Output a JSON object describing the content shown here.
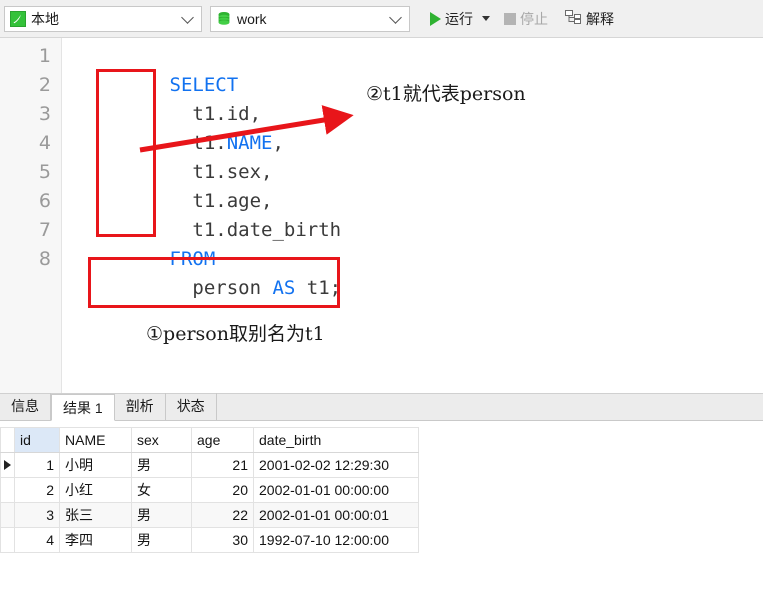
{
  "toolbar": {
    "connection": {
      "label": "本地",
      "icon": "connection-icon"
    },
    "database": {
      "label": "work",
      "icon": "database-icon"
    },
    "run": {
      "label": "运行",
      "icon": "play-icon"
    },
    "stop": {
      "label": "停止",
      "icon": "stop-icon"
    },
    "explain": {
      "label": "解释",
      "icon": "explain-icon"
    }
  },
  "editor": {
    "line_numbers": [
      "1",
      "2",
      "3",
      "4",
      "5",
      "6",
      "7",
      "8"
    ],
    "lines": [
      {
        "keyword": "SELECT",
        "plain": ""
      },
      {
        "keyword": "",
        "plain": "  t1.id,"
      },
      {
        "keyword": "",
        "plain": "  t1.",
        "keyword2": "NAME",
        "plain2": ","
      },
      {
        "keyword": "",
        "plain": "  t1.sex,"
      },
      {
        "keyword": "",
        "plain": "  t1.age,"
      },
      {
        "keyword": "",
        "plain": "  t1.date_birth"
      },
      {
        "keyword": "FROM",
        "plain": ""
      },
      {
        "keyword": "",
        "plain": "  person ",
        "keyword2": "AS",
        "plain2": " t1;"
      }
    ]
  },
  "annotations": [
    {
      "text": "②t1就代表person",
      "name": "annotation-two"
    },
    {
      "text": "①person取别名为t1",
      "name": "annotation-one"
    }
  ],
  "result_tabs": [
    {
      "label": "信息",
      "active": false
    },
    {
      "label": "结果 1",
      "active": true
    },
    {
      "label": "剖析",
      "active": false
    },
    {
      "label": "状态",
      "active": false
    }
  ],
  "result_grid": {
    "columns": [
      "id",
      "NAME",
      "sex",
      "age",
      "date_birth"
    ],
    "rows": [
      {
        "id": "1",
        "NAME": "小明",
        "sex": "男",
        "age": "21",
        "date_birth": "2001-02-02 12:29:30",
        "selected": true
      },
      {
        "id": "2",
        "NAME": "小红",
        "sex": "女",
        "age": "20",
        "date_birth": "2002-01-01 00:00:00",
        "selected": false
      },
      {
        "id": "3",
        "NAME": "张三",
        "sex": "男",
        "age": "22",
        "date_birth": "2002-01-01 00:00:01",
        "selected": false
      },
      {
        "id": "4",
        "NAME": "李四",
        "sex": "男",
        "age": "30",
        "date_birth": "1992-07-10 12:00:00",
        "selected": false
      }
    ]
  },
  "colors": {
    "keyword": "#1272f0",
    "annotation_red": "#e8151a",
    "run_green": "#2fb232",
    "id_header_highlight": "#dce8f7"
  }
}
